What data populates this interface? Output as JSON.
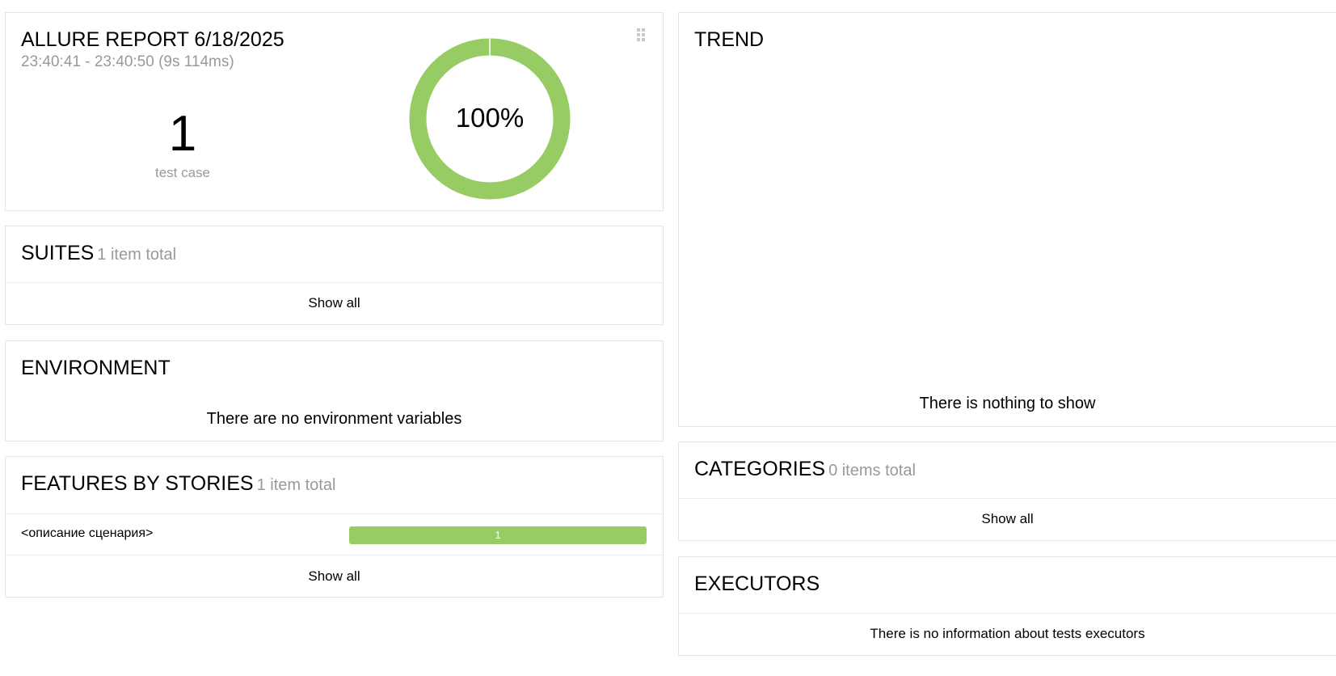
{
  "summary": {
    "title": "ALLURE REPORT 6/18/2025",
    "time_range": "23:40:41 - 23:40:50 (9s 114ms)",
    "test_count": "1",
    "test_count_label": "test case",
    "percent": "100%",
    "passed_fraction": 1.0
  },
  "suites": {
    "title": "SUITES",
    "count": "1 item total",
    "show_all": "Show all"
  },
  "environment": {
    "title": "ENVIRONMENT",
    "empty_text": "There are no environment variables"
  },
  "features": {
    "title": "FEATURES BY STORIES",
    "count": "1 item total",
    "rows": [
      {
        "label": "<описание сценария>",
        "passed": "1"
      }
    ],
    "show_all": "Show all"
  },
  "trend": {
    "title": "TREND",
    "empty_text": "There is nothing to show"
  },
  "categories": {
    "title": "CATEGORIES",
    "count": "0 items total",
    "show_all": "Show all"
  },
  "executors": {
    "title": "EXECUTORS",
    "empty_text": "There is no information about tests executors"
  },
  "colors": {
    "passed": "#97cc64",
    "border": "#e4e4e4",
    "muted": "#999999"
  },
  "icons": {
    "drag_handle": "drag-handle-icon"
  }
}
